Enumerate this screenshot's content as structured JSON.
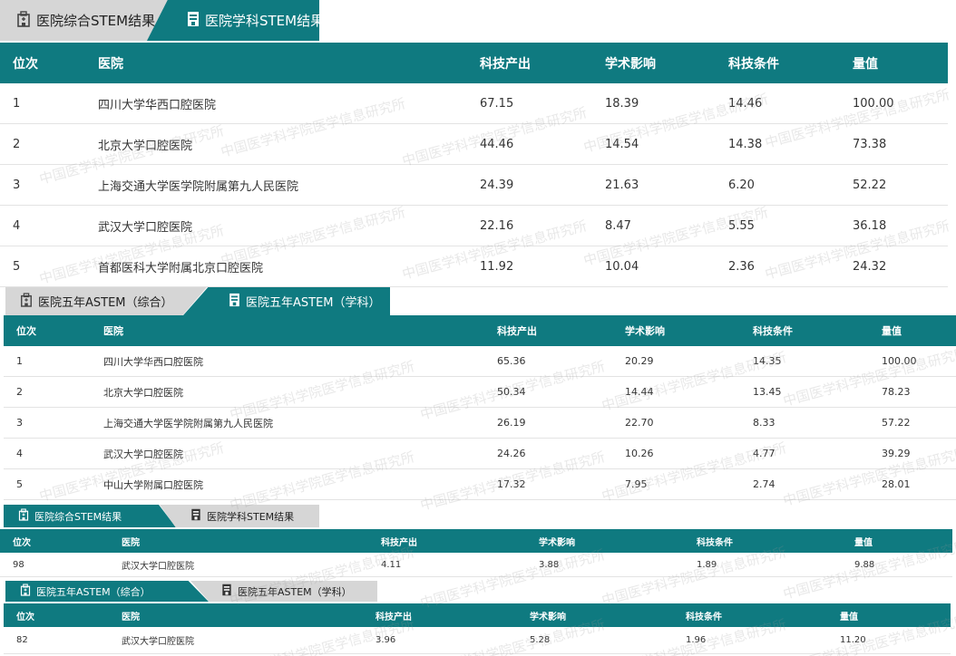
{
  "watermark": "中国医学科学院医学信息研究所",
  "colors": {
    "teal": "#0f7a80",
    "tab_gray": "#d6d6d6"
  },
  "s1": {
    "tabs": [
      {
        "label": "医院综合STEM结果",
        "icon": "hospital-building-icon"
      },
      {
        "label": "医院学科STEM结果",
        "icon": "department-document-icon"
      }
    ],
    "headers": [
      "位次",
      "医院",
      "科技产出",
      "学术影响",
      "科技条件",
      "量值"
    ],
    "rows": [
      [
        "1",
        "四川大学华西口腔医院",
        "67.15",
        "18.39",
        "14.46",
        "100.00"
      ],
      [
        "2",
        "北京大学口腔医院",
        "44.46",
        "14.54",
        "14.38",
        "73.38"
      ],
      [
        "3",
        "上海交通大学医学院附属第九人民医院",
        "24.39",
        "21.63",
        "6.20",
        "52.22"
      ],
      [
        "4",
        "武汉大学口腔医院",
        "22.16",
        "8.47",
        "5.55",
        "36.18"
      ],
      [
        "5",
        "首都医科大学附属北京口腔医院",
        "11.92",
        "10.04",
        "2.36",
        "24.32"
      ]
    ]
  },
  "s2": {
    "tabs": [
      {
        "label": "医院五年ASTEM（综合）",
        "icon": "hospital-building-icon"
      },
      {
        "label": "医院五年ASTEM（学科）",
        "icon": "department-document-icon"
      }
    ],
    "headers": [
      "位次",
      "医院",
      "科技产出",
      "学术影响",
      "科技条件",
      "量值"
    ],
    "rows": [
      [
        "1",
        "四川大学华西口腔医院",
        "65.36",
        "20.29",
        "14.35",
        "100.00"
      ],
      [
        "2",
        "北京大学口腔医院",
        "50.34",
        "14.44",
        "13.45",
        "78.23"
      ],
      [
        "3",
        "上海交通大学医学院附属第九人民医院",
        "26.19",
        "22.70",
        "8.33",
        "57.22"
      ],
      [
        "4",
        "武汉大学口腔医院",
        "24.26",
        "10.26",
        "4.77",
        "39.29"
      ],
      [
        "5",
        "中山大学附属口腔医院",
        "17.32",
        "7.95",
        "2.74",
        "28.01"
      ]
    ]
  },
  "s3": {
    "tabs": [
      {
        "label": "医院综合STEM结果",
        "icon": "hospital-building-icon"
      },
      {
        "label": "医院学科STEM结果",
        "icon": "department-document-icon"
      }
    ],
    "headers": [
      "位次",
      "医院",
      "科技产出",
      "学术影响",
      "科技条件",
      "量值"
    ],
    "rows": [
      [
        "98",
        "武汉大学口腔医院",
        "4.11",
        "3.88",
        "1.89",
        "9.88"
      ]
    ]
  },
  "s4": {
    "tabs": [
      {
        "label": "医院五年ASTEM（综合）",
        "icon": "hospital-building-icon"
      },
      {
        "label": "医院五年ASTEM（学科）",
        "icon": "department-document-icon"
      }
    ],
    "headers": [
      "位次",
      "医院",
      "科技产出",
      "学术影响",
      "科技条件",
      "量值"
    ],
    "rows": [
      [
        "82",
        "武汉大学口腔医院",
        "3.96",
        "5.28",
        "1.96",
        "11.20"
      ]
    ]
  }
}
